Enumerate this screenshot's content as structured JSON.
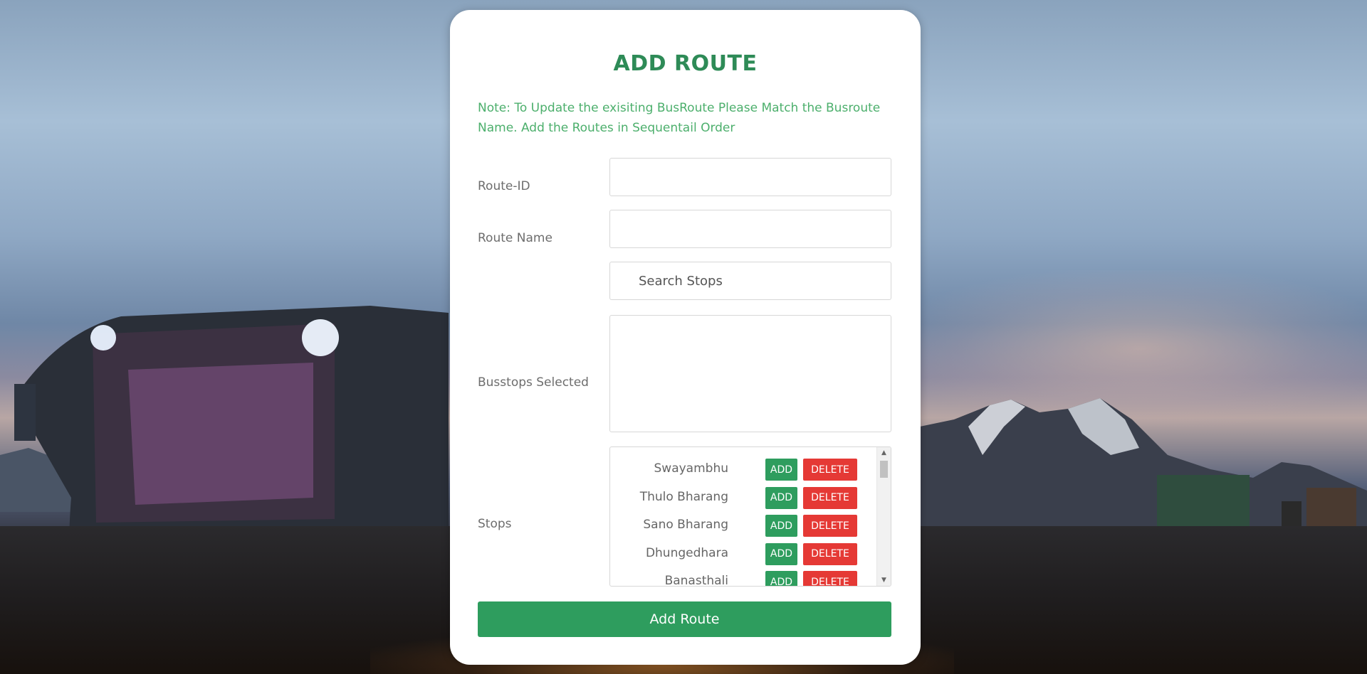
{
  "form": {
    "title": "ADD ROUTE",
    "note": "Note: To Update the exisiting BusRoute Please Match the Busroute Name. Add the Routes in Sequentail Order",
    "route_id_label": "Route-ID",
    "route_id_value": "",
    "route_name_label": "Route Name",
    "route_name_value": "",
    "search_placeholder": "Search Stops",
    "busstops_selected_label": "Busstops Selected",
    "busstops_selected_value": "",
    "stops_label": "Stops",
    "submit_label": "Add Route"
  },
  "stops": [
    {
      "name": "Swayambhu",
      "add_label": "ADD",
      "delete_label": "DELETE"
    },
    {
      "name": "Thulo Bharang",
      "add_label": "ADD",
      "delete_label": "DELETE"
    },
    {
      "name": "Sano Bharang",
      "add_label": "ADD",
      "delete_label": "DELETE"
    },
    {
      "name": "Dhungedhara",
      "add_label": "ADD",
      "delete_label": "DELETE"
    },
    {
      "name": "Banasthali",
      "add_label": "ADD",
      "delete_label": "DELETE"
    }
  ],
  "icons": {
    "scroll_up": "▲",
    "scroll_down": "▼"
  },
  "colors": {
    "accent_green": "#2e9d5e",
    "title_green": "#2e8b57",
    "delete_red": "#e53935"
  }
}
